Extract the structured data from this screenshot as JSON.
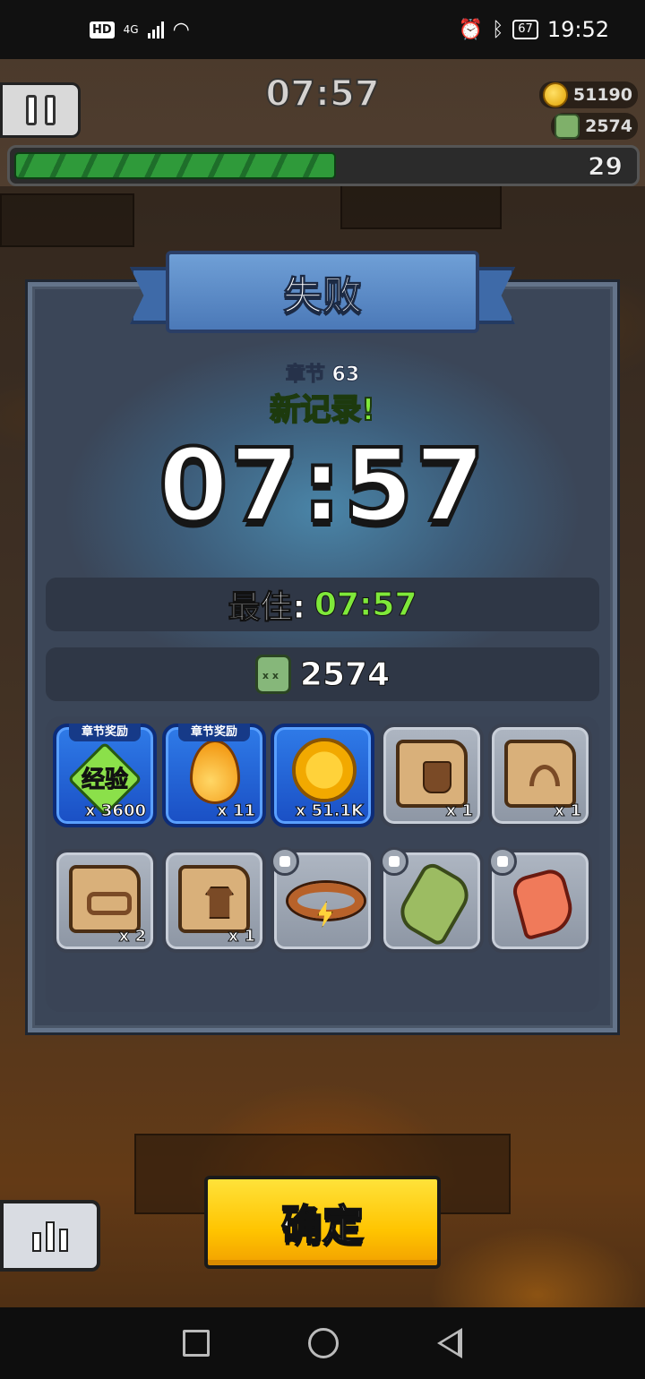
{
  "status_bar": {
    "hd": "HD",
    "network": "4G",
    "battery": "67",
    "time": "19:52"
  },
  "hud": {
    "timer": "07:57",
    "coins": "51190",
    "kills": "2574",
    "level": "29",
    "xp_progress": 0.52
  },
  "result": {
    "title": "失败",
    "chapter": "章节 63",
    "new_record": "新记录!",
    "time": "07:57",
    "best_label": "最佳:",
    "best_value": "07:57",
    "kills_value": "2574"
  },
  "rewards": [
    {
      "type": "chapter_reward",
      "tag": "章节奖励",
      "label": "经验",
      "qty": "x 3600",
      "icon": "xp-gem-icon"
    },
    {
      "type": "chapter_reward",
      "tag": "章节奖励",
      "qty": "x 11",
      "icon": "energy-drop-icon"
    },
    {
      "type": "chapter_reward",
      "qty": "x 51.1K",
      "icon": "gold-coin-icon"
    },
    {
      "type": "scroll",
      "qty": "x 1",
      "icon": "glove-scroll-icon"
    },
    {
      "type": "scroll",
      "qty": "x 1",
      "icon": "necklace-scroll-icon"
    },
    {
      "type": "scroll",
      "qty": "x 2",
      "icon": "belt-scroll-icon"
    },
    {
      "type": "scroll",
      "qty": "x 1",
      "icon": "armor-scroll-icon"
    },
    {
      "type": "equipment",
      "icon": "lightning-belt-icon",
      "slot_icon": "belt-slot-icon"
    },
    {
      "type": "equipment",
      "icon": "zombie-glove-icon",
      "slot_icon": "glove-slot-icon"
    },
    {
      "type": "equipment",
      "icon": "claw-boot-icon",
      "slot_icon": "boot-slot-icon"
    }
  ],
  "buttons": {
    "confirm": "确定"
  },
  "colors": {
    "record_green": "#7fe83a",
    "confirm_yellow": "#ffc400",
    "panel_blue": "#4a5668"
  }
}
